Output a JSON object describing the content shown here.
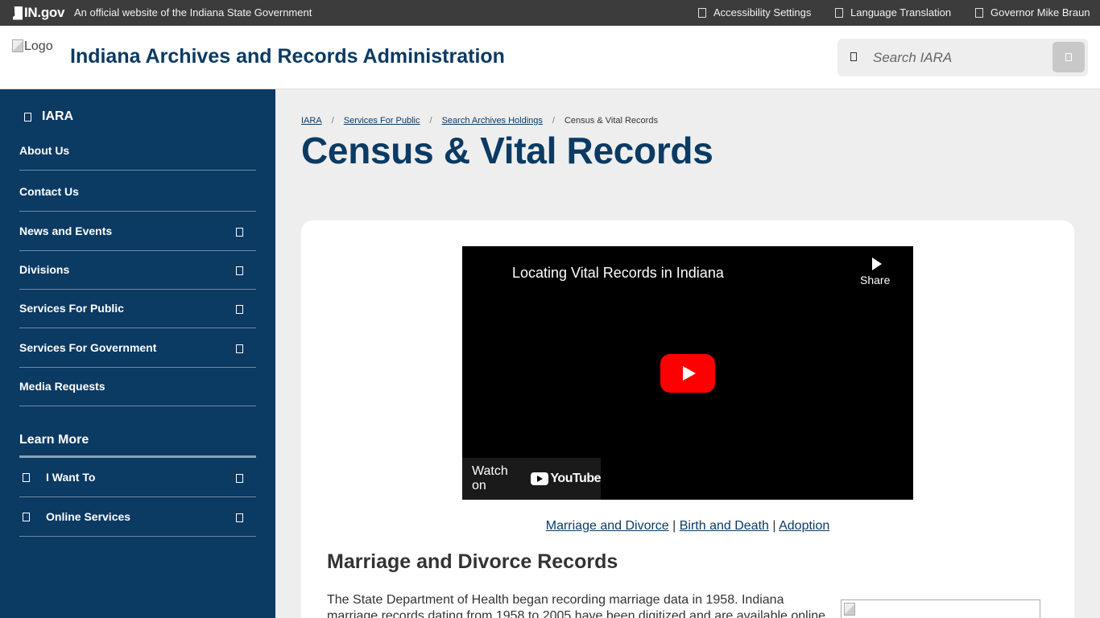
{
  "topbar": {
    "brand": "IN.gov",
    "official": "An official website of the Indiana State Government",
    "links": [
      "Accessibility Settings",
      "Language Translation",
      "Governor Mike Braun"
    ]
  },
  "header": {
    "logo_alt": "Logo",
    "site_title": "Indiana Archives and Records Administration",
    "search_placeholder": "Search IARA"
  },
  "sidebar": {
    "home": "IARA",
    "items": [
      {
        "label": "About Us"
      },
      {
        "label": "Contact Us"
      },
      {
        "label": "News and Events"
      },
      {
        "label": "Divisions"
      },
      {
        "label": "Services For Public"
      },
      {
        "label": "Services For Government"
      },
      {
        "label": "Media Requests"
      }
    ],
    "learn_more": "Learn More",
    "learn_items": [
      {
        "label": "I Want To"
      },
      {
        "label": "Online Services"
      }
    ]
  },
  "breadcrumb": [
    "IARA",
    "Services For Public",
    "Search Archives Holdings",
    "Census & Vital Records"
  ],
  "page_title": "Census & Vital Records",
  "video": {
    "title": "Locating Vital Records in Indiana",
    "share": "Share",
    "watch_on": "Watch on",
    "youtube": "YouTube"
  },
  "jumplinks": [
    "Marriage and Divorce",
    "Birth and Death",
    "Adoption"
  ],
  "section_title": "Marriage and Divorce Records",
  "paragraph": "The State Department of Health began recording marriage data in 1958. Indiana marriage records dating from 1958 to 2005 have been digitized and are available online"
}
